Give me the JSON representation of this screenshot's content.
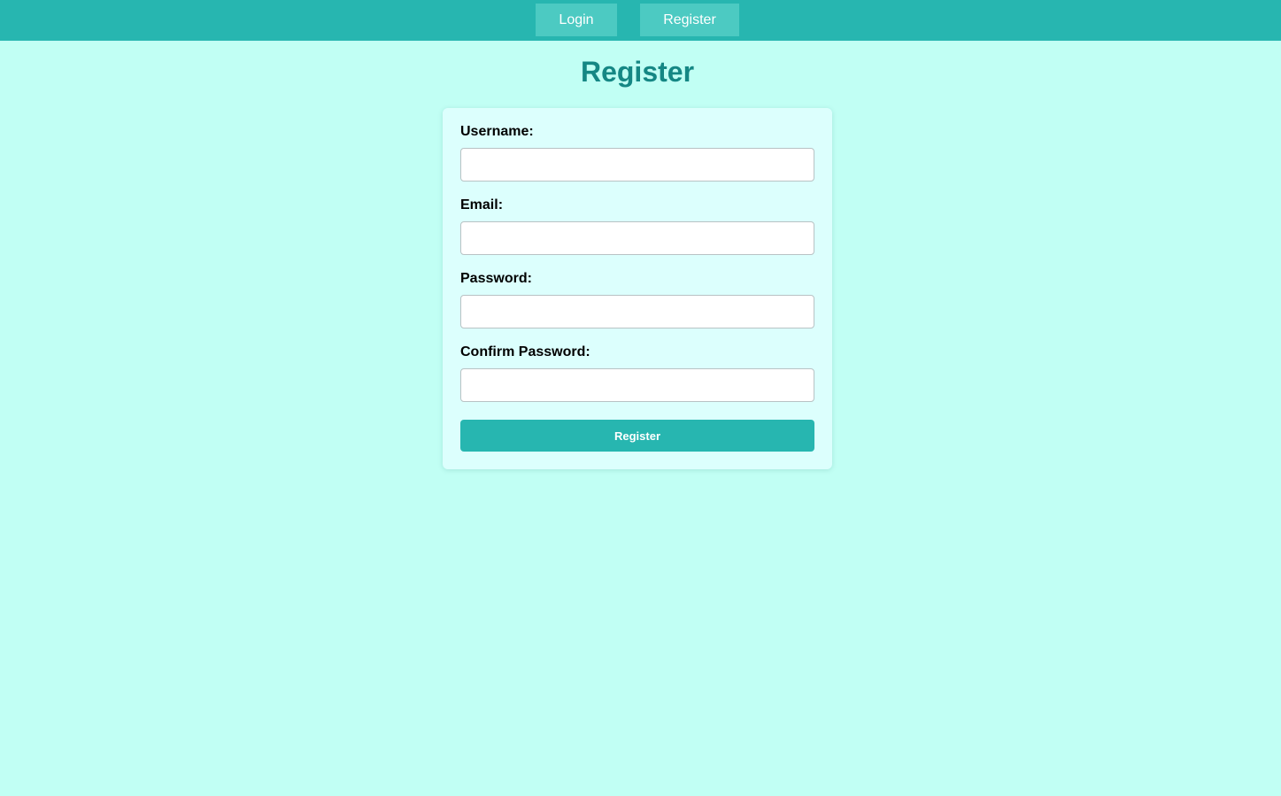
{
  "nav": {
    "login_label": "Login",
    "register_label": "Register"
  },
  "page": {
    "title": "Register"
  },
  "form": {
    "username_label": "Username:",
    "username_value": "",
    "email_label": "Email:",
    "email_value": "",
    "password_label": "Password:",
    "password_value": "",
    "confirm_password_label": "Confirm Password:",
    "confirm_password_value": "",
    "submit_label": "Register"
  },
  "colors": {
    "nav_background": "#27b6b0",
    "nav_button": "#4ccac2",
    "page_background": "#c1fff4",
    "title": "#158784",
    "card_background": "#dcfffd",
    "button": "#27b6b0"
  }
}
